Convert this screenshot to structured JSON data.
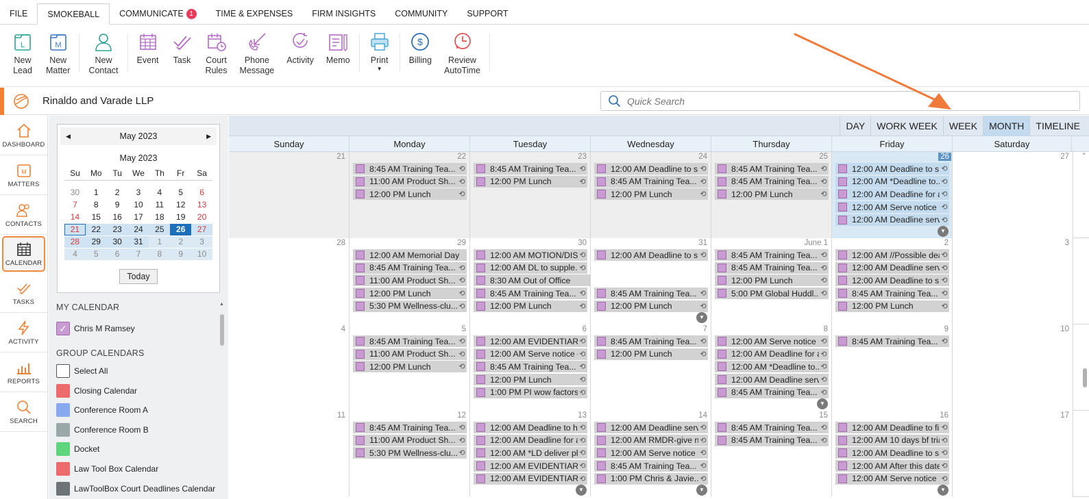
{
  "menu": [
    {
      "label": "FILE"
    },
    {
      "label": "SMOKEBALL",
      "active": true
    },
    {
      "label": "COMMUNICATE",
      "badge": "1"
    },
    {
      "label": "TIME & EXPENSES"
    },
    {
      "label": "FIRM INSIGHTS"
    },
    {
      "label": "COMMUNITY"
    },
    {
      "label": "SUPPORT"
    }
  ],
  "ribbon": {
    "new_lead": "New\nLead",
    "new_matter": "New\nMatter",
    "new_contact": "New\nContact",
    "event": "Event",
    "task": "Task",
    "court_rules": "Court\nRules",
    "phone_message": "Phone\nMessage",
    "activity": "Activity",
    "memo": "Memo",
    "print": "Print",
    "billing": "Billing",
    "review_autotime": "Review\nAutoTime"
  },
  "firm": {
    "name": "Rinaldo and Varade LLP"
  },
  "search": {
    "placeholder": "Quick Search"
  },
  "nav": [
    "DASHBOARD",
    "MATTERS",
    "CONTACTS",
    "CALENDAR",
    "TASKS",
    "ACTIVITY",
    "REPORTS",
    "SEARCH"
  ],
  "minical": {
    "header": "May 2023",
    "title": "May 2023",
    "dow": [
      "Su",
      "Mo",
      "Tu",
      "We",
      "Th",
      "Fr",
      "Sa"
    ],
    "weeks": [
      [
        "30",
        "1",
        "2",
        "3",
        "4",
        "5",
        "6"
      ],
      [
        "7",
        "8",
        "9",
        "10",
        "11",
        "12",
        "13"
      ],
      [
        "14",
        "15",
        "16",
        "17",
        "18",
        "19",
        "20"
      ],
      [
        "21",
        "22",
        "23",
        "24",
        "25",
        "26",
        "27"
      ],
      [
        "28",
        "29",
        "30",
        "31",
        "1",
        "2",
        "3"
      ],
      [
        "4",
        "5",
        "6",
        "7",
        "8",
        "9",
        "10"
      ]
    ],
    "today_label": "Today"
  },
  "my_calendar": {
    "heading": "MY CALENDAR",
    "items": [
      {
        "label": "Chris M Ramsey",
        "color": "#c99bd3",
        "checked": true
      }
    ]
  },
  "group_calendars": {
    "heading": "GROUP CALENDARS",
    "items": [
      {
        "label": "Select All",
        "color": "#ffffff"
      },
      {
        "label": "Closing Calendar",
        "color": "#ee6b6b"
      },
      {
        "label": "Conference Room A",
        "color": "#86a8ee"
      },
      {
        "label": "Conference Room B",
        "color": "#9aa8a8"
      },
      {
        "label": "Docket",
        "color": "#5fd57e"
      },
      {
        "label": "Law Tool Box Calendar",
        "color": "#ee6b6b"
      },
      {
        "label": "LawToolBox Court Deadlines Calendar",
        "color": "#6e7377"
      }
    ]
  },
  "views": [
    "DAY",
    "WORK WEEK",
    "WEEK",
    "MONTH",
    "TIMELINE"
  ],
  "days_of_week": [
    "Sunday",
    "Monday",
    "Tuesday",
    "Wednesday",
    "Thursday",
    "Friday",
    "Saturday"
  ],
  "weeks": [
    {
      "days": [
        {
          "num": "21",
          "past": true,
          "events": []
        },
        {
          "num": "22",
          "past": true,
          "events": [
            {
              "time": "8:45 AM",
              "title": "Training Tea..."
            },
            {
              "time": "11:00 AM",
              "title": "Product Sh..."
            },
            {
              "time": "12:00 PM",
              "title": "Lunch"
            }
          ]
        },
        {
          "num": "23",
          "past": true,
          "events": [
            {
              "time": "8:45 AM",
              "title": "Training Tea..."
            },
            {
              "time": "12:00 PM",
              "title": "Lunch"
            }
          ]
        },
        {
          "num": "24",
          "past": true,
          "events": [
            {
              "time": "12:00 AM",
              "title": "Deadline to s..."
            },
            {
              "time": "8:45 AM",
              "title": "Training Tea..."
            },
            {
              "time": "12:00 PM",
              "title": "Lunch"
            }
          ]
        },
        {
          "num": "25",
          "past": true,
          "events": [
            {
              "time": "8:45 AM",
              "title": "Training Tea..."
            },
            {
              "time": "8:45 AM",
              "title": "Training Tea..."
            },
            {
              "time": "12:00 PM",
              "title": "Lunch"
            }
          ]
        },
        {
          "num": "26",
          "selected": true,
          "more": true,
          "events": [
            {
              "time": "12:00 AM",
              "title": "Deadline to s..."
            },
            {
              "time": "12:00 AM",
              "title": "*Deadline to..."
            },
            {
              "time": "12:00 AM",
              "title": "Deadline for a..."
            },
            {
              "time": "12:00 AM",
              "title": "Serve notice r..."
            },
            {
              "time": "12:00 AM",
              "title": "Deadline serv..."
            }
          ]
        },
        {
          "num": "27",
          "events": []
        }
      ]
    },
    {
      "days": [
        {
          "num": "28",
          "events": []
        },
        {
          "num": "29",
          "events": [
            {
              "time": "12:00 AM",
              "title": "Memorial Day"
            },
            {
              "time": "8:45 AM",
              "title": "Training Tea..."
            },
            {
              "time": "11:00 AM",
              "title": "Product Sh..."
            },
            {
              "time": "12:00 PM",
              "title": "Lunch"
            },
            {
              "time": "5:30 PM",
              "title": "Wellness-clu..."
            }
          ]
        },
        {
          "num": "30",
          "events": [
            {
              "time": "12:00 AM",
              "title": "MOTION/DIS..."
            },
            {
              "time": "12:00 AM",
              "title": "DL to supple..."
            },
            {
              "time": "8:30 AM",
              "title": "Out of Office",
              "span": true
            },
            {
              "time": "8:45 AM",
              "title": "Training Tea..."
            },
            {
              "time": "12:00 PM",
              "title": "Lunch"
            }
          ]
        },
        {
          "num": "31",
          "more": true,
          "events": [
            {
              "time": "12:00 AM",
              "title": "Deadline to s..."
            },
            null,
            null,
            {
              "time": "8:45 AM",
              "title": "Training Tea..."
            },
            {
              "time": "12:00 PM",
              "title": "Lunch"
            }
          ]
        },
        {
          "num": "June 1",
          "events": [
            {
              "time": "8:45 AM",
              "title": "Training Tea..."
            },
            {
              "time": "8:45 AM",
              "title": "Training Tea..."
            },
            {
              "time": "12:00 PM",
              "title": "Lunch"
            },
            {
              "time": "5:00 PM",
              "title": "Global Huddl..."
            }
          ]
        },
        {
          "num": "2",
          "events": [
            {
              "time": "12:00 AM",
              "title": "//Possible dea..."
            },
            {
              "time": "12:00 AM",
              "title": "Deadline serv..."
            },
            {
              "time": "12:00 AM",
              "title": "Deadline to s..."
            },
            {
              "time": "8:45 AM",
              "title": "Training Tea..."
            },
            {
              "time": "12:00 PM",
              "title": "Lunch"
            }
          ]
        },
        {
          "num": "3",
          "events": []
        }
      ]
    },
    {
      "days": [
        {
          "num": "4",
          "events": []
        },
        {
          "num": "5",
          "events": [
            {
              "time": "8:45 AM",
              "title": "Training Tea..."
            },
            {
              "time": "11:00 AM",
              "title": "Product Sh..."
            },
            {
              "time": "12:00 PM",
              "title": "Lunch"
            }
          ]
        },
        {
          "num": "6",
          "events": [
            {
              "time": "12:00 AM",
              "title": "EVIDENTIARY..."
            },
            {
              "time": "12:00 AM",
              "title": "Serve notice o..."
            },
            {
              "time": "8:45 AM",
              "title": "Training Tea..."
            },
            {
              "time": "12:00 PM",
              "title": "Lunch"
            },
            {
              "time": "1:00 PM",
              "title": "PI wow factors..."
            }
          ]
        },
        {
          "num": "7",
          "events": [
            {
              "time": "8:45 AM",
              "title": "Training Tea..."
            },
            {
              "time": "12:00 PM",
              "title": "Lunch"
            }
          ]
        },
        {
          "num": "8",
          "more": true,
          "events": [
            {
              "time": "12:00 AM",
              "title": "Serve notice r..."
            },
            {
              "time": "12:00 AM",
              "title": "Deadline for a..."
            },
            {
              "time": "12:00 AM",
              "title": "*Deadline to..."
            },
            {
              "time": "12:00 AM",
              "title": "Deadline serv..."
            },
            {
              "time": "8:45 AM",
              "title": "Training Tea..."
            }
          ]
        },
        {
          "num": "9",
          "events": [
            {
              "time": "8:45 AM",
              "title": "Training Tea..."
            }
          ]
        },
        {
          "num": "10",
          "events": []
        }
      ]
    },
    {
      "days": [
        {
          "num": "11",
          "events": []
        },
        {
          "num": "12",
          "events": [
            {
              "time": "8:45 AM",
              "title": "Training Tea..."
            },
            {
              "time": "11:00 AM",
              "title": "Product Sh..."
            },
            {
              "time": "5:30 PM",
              "title": "Wellness-clu..."
            }
          ]
        },
        {
          "num": "13",
          "more": true,
          "events": [
            {
              "time": "12:00 AM",
              "title": "Deadline to h..."
            },
            {
              "time": "12:00 AM",
              "title": "Deadline for a..."
            },
            {
              "time": "12:00 AM",
              "title": "*LD deliver ph..."
            },
            {
              "time": "12:00 AM",
              "title": "EVIDENTIARY..."
            },
            {
              "time": "12:00 AM",
              "title": "EVIDENTIARY..."
            }
          ]
        },
        {
          "num": "14",
          "more": true,
          "events": [
            {
              "time": "12:00 AM",
              "title": "Deadline serv..."
            },
            {
              "time": "12:00 AM",
              "title": "RMDR-give n..."
            },
            {
              "time": "12:00 AM",
              "title": "Serve notice r..."
            },
            {
              "time": "8:45 AM",
              "title": "Training Tea..."
            },
            {
              "time": "1:00 PM",
              "title": "Chris & Javie..."
            }
          ]
        },
        {
          "num": "15",
          "events": [
            {
              "time": "8:45 AM",
              "title": "Training Tea..."
            },
            {
              "time": "8:45 AM",
              "title": "Training Tea..."
            }
          ]
        },
        {
          "num": "16",
          "more": true,
          "events": [
            {
              "time": "12:00 AM",
              "title": "Deadline to fil..."
            },
            {
              "time": "12:00 AM",
              "title": "10 days bf tria..."
            },
            {
              "time": "12:00 AM",
              "title": "Deadline to s..."
            },
            {
              "time": "12:00 AM",
              "title": "After this date..."
            },
            {
              "time": "12:00 AM",
              "title": "Serve notice r..."
            }
          ]
        },
        {
          "num": "17",
          "events": []
        }
      ]
    }
  ]
}
